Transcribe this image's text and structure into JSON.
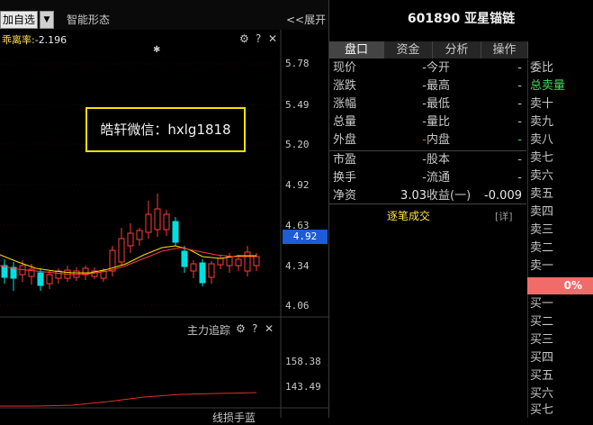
{
  "toolbar": {
    "watch_label": "加自选",
    "watch_arrow": "▼",
    "pattern_label": "智能形态",
    "expand_label": "<<展开"
  },
  "indicator": {
    "bias_label": "乖离率:",
    "bias_value": "-2.196"
  },
  "price_axis": [
    "5.78",
    "5.49",
    "5.20",
    "4.92",
    "4.63",
    "4.34",
    "4.06"
  ],
  "current_price_tag": "4.92",
  "sub_panel": {
    "title": "主力追踪",
    "axis": [
      "158.38",
      "143.49"
    ]
  },
  "bottom_panel": {
    "title": "线损手蓝"
  },
  "overlay": {
    "text": "皓轩微信：hxlg1818"
  },
  "stock": {
    "code": "601890",
    "name": "亚星锚链"
  },
  "tabs": [
    "盘口",
    "资金",
    "分析",
    "操作"
  ],
  "info_rows": [
    {
      "l": "现价",
      "lv": "-",
      "r": "今开",
      "rv": "-"
    },
    {
      "l": "涨跌",
      "lv": "-",
      "r": "最高",
      "rv": "-"
    },
    {
      "l": "涨幅",
      "lv": "-",
      "r": "最低",
      "rv": "-"
    },
    {
      "l": "总量",
      "lv": "-",
      "r": "量比",
      "rv": "-"
    },
    {
      "l": "外盘",
      "lv": "-",
      "r": "内盘",
      "rv": "-"
    },
    {
      "l": "市盈",
      "lv": "-",
      "r": "股本",
      "rv": "-"
    },
    {
      "l": "换手",
      "lv": "-",
      "r": "流通",
      "rv": "-"
    },
    {
      "l": "净资",
      "lv": "3.03",
      "r": "收益(一)",
      "rv": "-0.009"
    }
  ],
  "trade_link": "逐笔成交",
  "detail_link": "[详]",
  "order_book": {
    "ratio_label": "委比",
    "total_label": "总卖量",
    "sell": [
      "卖十",
      "卖九",
      "卖八",
      "卖七",
      "卖六",
      "卖五",
      "卖四",
      "卖三",
      "卖二",
      "卖一"
    ],
    "pct": "0%",
    "buy": [
      "买一",
      "买二",
      "买三",
      "买四",
      "买五",
      "买六",
      "买七"
    ]
  },
  "colors": {
    "up": "#ff3b3b",
    "down": "#00e0e0",
    "ma_yellow": "#ffe000",
    "ma_red": "#ff3b3b",
    "tag_blue": "#1d5bd8"
  }
}
